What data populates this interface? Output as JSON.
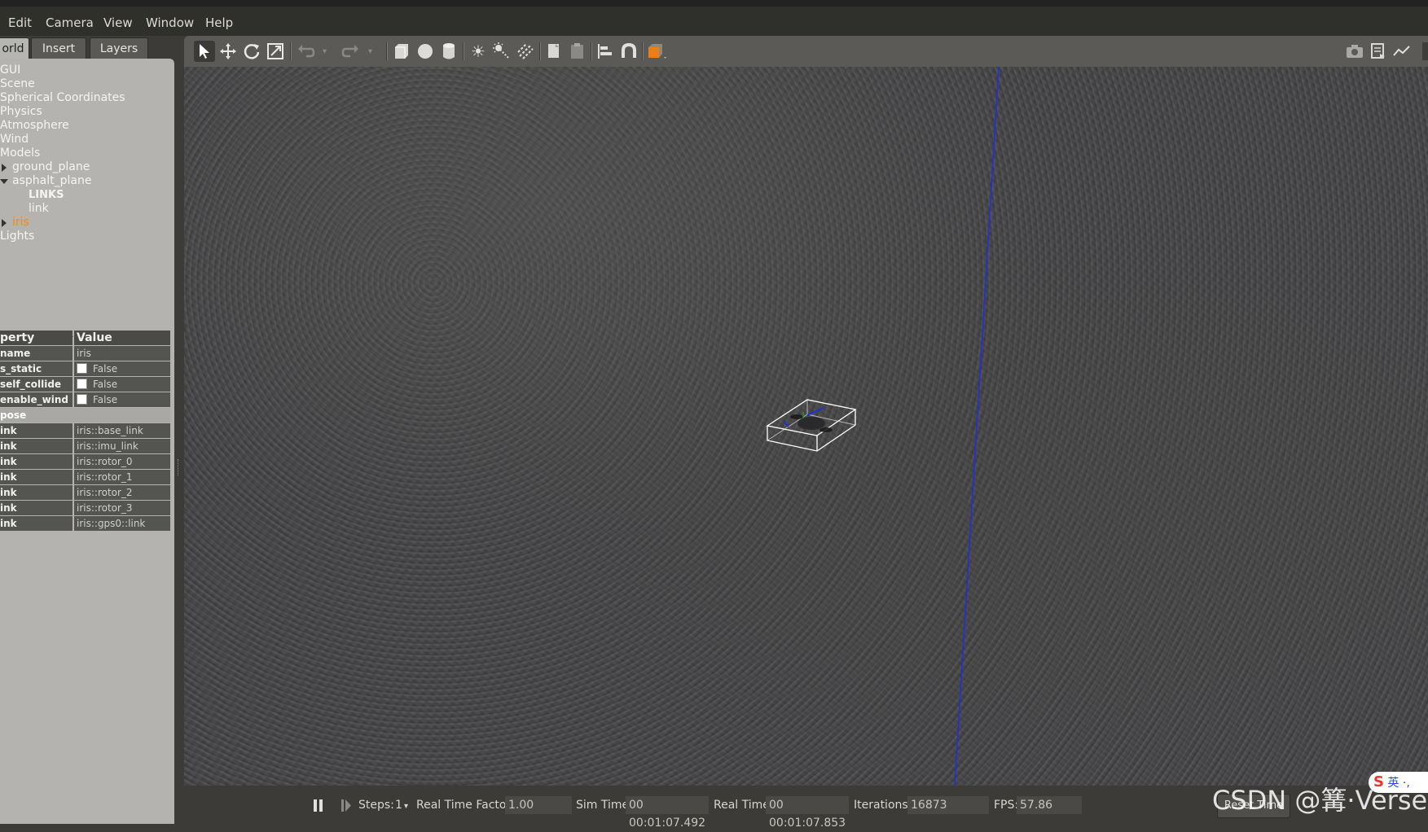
{
  "menubar": {
    "items": [
      {
        "label": "Edit",
        "mnemonic": "E"
      },
      {
        "label": "Camera",
        "mnemonic": "C"
      },
      {
        "label": "View",
        "mnemonic": "V"
      },
      {
        "label": "Window",
        "mnemonic": "W"
      },
      {
        "label": "Help",
        "mnemonic": "H"
      }
    ]
  },
  "tabs": [
    "orld",
    "Insert",
    "Layers"
  ],
  "tree": {
    "items": [
      "GUI",
      "Scene",
      "Spherical Coordinates",
      "Physics",
      "Atmosphere",
      "Wind",
      "Models"
    ],
    "models": [
      "ground_plane",
      "asphalt_plane"
    ],
    "asphalt_children": [
      "LINKS",
      "link"
    ],
    "selected_model": "iris",
    "lights": "Lights"
  },
  "properties": {
    "header": {
      "key": "perty",
      "value": "Value"
    },
    "rows": [
      {
        "key": "name",
        "value": "iris"
      },
      {
        "key": "s_static",
        "value": "False",
        "checkbox": true
      },
      {
        "key": "self_collide",
        "value": "False",
        "checkbox": true
      },
      {
        "key": "enable_wind",
        "value": "False",
        "checkbox": true
      }
    ],
    "group": "pose",
    "links": [
      {
        "key": "ink",
        "value": "iris::base_link"
      },
      {
        "key": "ink",
        "value": "iris::imu_link"
      },
      {
        "key": "ink",
        "value": "iris::rotor_0"
      },
      {
        "key": "ink",
        "value": "iris::rotor_1"
      },
      {
        "key": "ink",
        "value": "iris::rotor_2"
      },
      {
        "key": "ink",
        "value": "iris::rotor_3"
      },
      {
        "key": "ink",
        "value": "iris::gps0::link"
      }
    ]
  },
  "toolbar": {
    "icons": [
      "select-arrow-icon",
      "translate-icon",
      "rotate-icon",
      "scale-icon",
      "undo-icon",
      "redo-icon",
      "box-icon",
      "sphere-icon",
      "cylinder-icon",
      "point-light-icon",
      "spot-light-icon",
      "directional-light-icon",
      "copy-icon",
      "paste-icon",
      "align-icon",
      "snap-icon",
      "view-angle-icon",
      "screenshot-icon",
      "log-icon",
      "plot-icon"
    ]
  },
  "bottom": {
    "steps_label": "Steps:",
    "steps_value": "1",
    "rtf_label": "Real Time Factor:",
    "rtf_value": "1.00",
    "sim_label": "Sim Time:",
    "sim_value": "00 00:01:07.492",
    "real_label": "Real Time:",
    "real_value": "00 00:01:07.853",
    "iter_label": "Iterations:",
    "iter_value": "16873",
    "fps_label": "FPS:",
    "fps_value": "57.86",
    "reset_label": "Reset Time"
  },
  "watermark": "CSDN @篝·Verse",
  "ime": {
    "logo": "S",
    "text": "英 ·,"
  },
  "colors": {
    "selection": "#f08a1f",
    "axis": "#2030d8"
  }
}
